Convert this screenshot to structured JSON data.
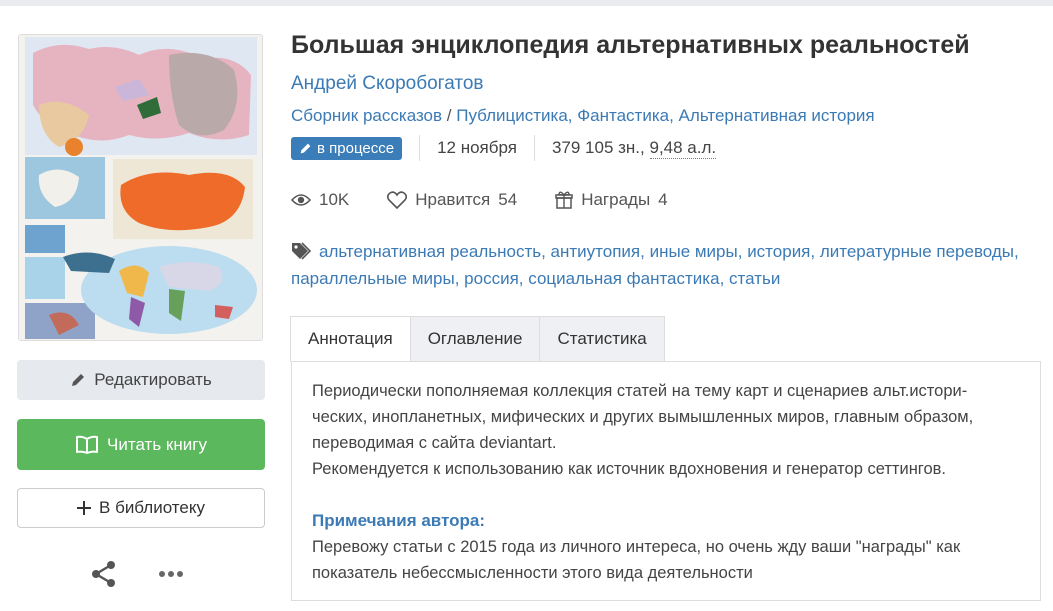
{
  "book": {
    "title": "Большая энциклопедия альтернативных реальностей",
    "author": "Андрей Скоробогатов",
    "form": "Сборник рассказов",
    "genres_sep": " / ",
    "genres": "Публицистика, Фантастика, Альтернативная история",
    "status": "в процессе",
    "date": "12 ноября",
    "size_chars": "379 105 зн.,",
    "size_al": "9,48 а.л."
  },
  "stats": {
    "views": "10K",
    "likes_label": "Нравится",
    "likes": "54",
    "awards_label": "Награды",
    "awards": "4"
  },
  "tags": [
    "альтернативная реальность",
    "антиутопия",
    "иные миры",
    "история",
    "литературные переводы",
    "параллельные миры",
    "россия",
    "социальная фантастика",
    "статьи"
  ],
  "actions": {
    "edit": "Редактировать",
    "read": "Читать книгу",
    "library": "В библиотеку"
  },
  "tabs": [
    "Аннотация",
    "Оглавление",
    "Статистика"
  ],
  "annotation": {
    "text": "Периодически пополняемая коллекция статей на тему карт и сценариев альт.истори-\nческих, инопланетных, мифических и других вымышленных миров, главным образом,\nпереводимая с сайта deviantart.\nРекомендуется к использованию как источник вдохновения и генератор сеттингов.",
    "notes_title": "Примечания автора:",
    "notes": "Перевожу статьи с 2015 года из личного интереса, но очень жду ваши \"награды\" как\nпоказатель небессмысленности этого вида деятельности"
  },
  "colors": {
    "link": "#3b7ab5",
    "read_button": "#5cb85c",
    "badge": "#3a7db8"
  }
}
